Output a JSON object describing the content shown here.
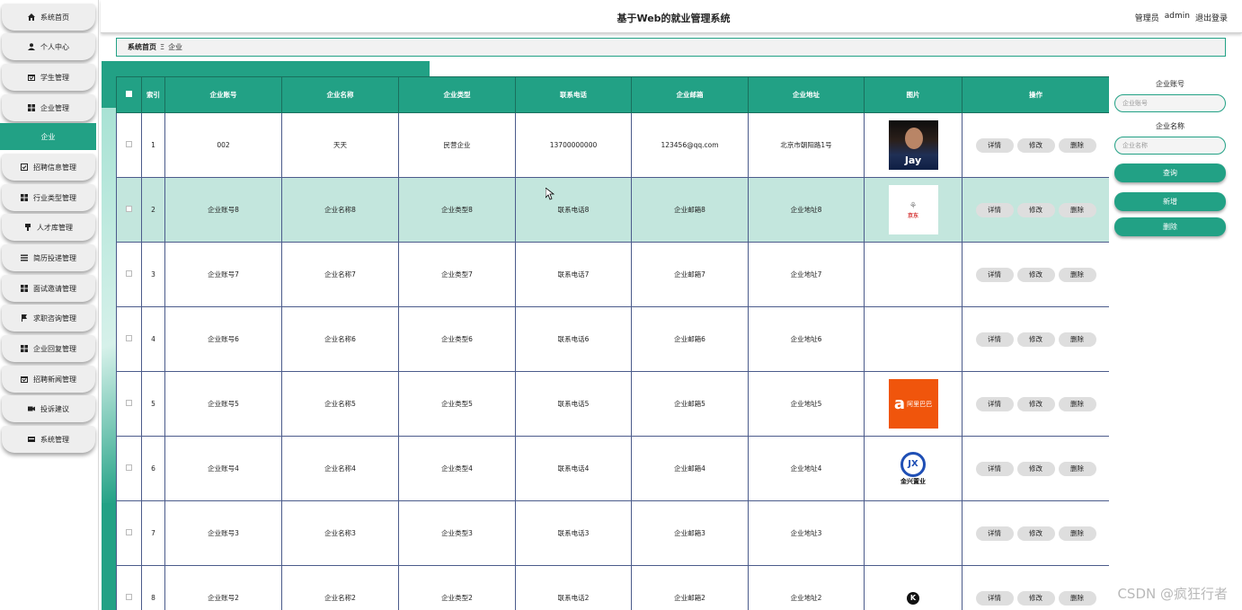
{
  "header": {
    "title": "基于Web的就业管理系统",
    "role": "管理员",
    "username": "admin",
    "logout": "退出登录"
  },
  "sidebar": {
    "items": [
      {
        "label": "系统首页",
        "icon": "home-icon"
      },
      {
        "label": "个人中心",
        "icon": "person-icon"
      },
      {
        "label": "学生管理",
        "icon": "calendar-icon"
      },
      {
        "label": "企业管理",
        "icon": "grid-icon"
      },
      {
        "label": "企业",
        "icon": "",
        "active": true
      },
      {
        "label": "招聘信息管理",
        "icon": "checklist-icon"
      },
      {
        "label": "行业类型管理",
        "icon": "grid-icon"
      },
      {
        "label": "人才库管理",
        "icon": "pin-icon"
      },
      {
        "label": "简历投递管理",
        "icon": "list-icon"
      },
      {
        "label": "面试邀请管理",
        "icon": "grid-icon"
      },
      {
        "label": "求职咨询管理",
        "icon": "flag-icon"
      },
      {
        "label": "企业回复管理",
        "icon": "grid-icon"
      },
      {
        "label": "招聘新闻管理",
        "icon": "calendar-icon"
      },
      {
        "label": "投诉建议",
        "icon": "video-icon"
      },
      {
        "label": "系统管理",
        "icon": "box-icon"
      }
    ]
  },
  "breadcrumb": {
    "home": "系统首页",
    "separator": "Ξ",
    "current": "企业"
  },
  "table": {
    "columns": [
      "索引",
      "企业账号",
      "企业名称",
      "企业类型",
      "联系电话",
      "企业邮箱",
      "企业地址",
      "图片",
      "操作"
    ],
    "actions": {
      "detail": "详情",
      "edit": "修改",
      "delete": "删除"
    },
    "rows": [
      {
        "index": "1",
        "account": "002",
        "name": "天天",
        "type": "民营企业",
        "phone": "13700000000",
        "email": "123456@qq.com",
        "address": "北京市朝阳路1号",
        "image": "photo-jay",
        "image_text": "Jay"
      },
      {
        "index": "2",
        "account": "企业账号8",
        "name": "企业名称8",
        "type": "企业类型8",
        "phone": "联系电话8",
        "email": "企业邮箱8",
        "address": "企业地址8",
        "image": "logo-jd",
        "image_text": "京东"
      },
      {
        "index": "3",
        "account": "企业账号7",
        "name": "企业名称7",
        "type": "企业类型7",
        "phone": "联系电话7",
        "email": "企业邮箱7",
        "address": "企业地址7",
        "image": "",
        "image_text": ""
      },
      {
        "index": "4",
        "account": "企业账号6",
        "name": "企业名称6",
        "type": "企业类型6",
        "phone": "联系电话6",
        "email": "企业邮箱6",
        "address": "企业地址6",
        "image": "",
        "image_text": ""
      },
      {
        "index": "5",
        "account": "企业账号5",
        "name": "企业名称5",
        "type": "企业类型5",
        "phone": "联系电话5",
        "email": "企业邮箱5",
        "address": "企业地址5",
        "image": "logo-alibaba",
        "image_text": "阿里巴巴"
      },
      {
        "index": "6",
        "account": "企业账号4",
        "name": "企业名称4",
        "type": "企业类型4",
        "phone": "联系电话4",
        "email": "企业邮箱4",
        "address": "企业地址4",
        "image": "logo-jinxing",
        "image_text": "金兴置业"
      },
      {
        "index": "7",
        "account": "企业账号3",
        "name": "企业名称3",
        "type": "企业类型3",
        "phone": "联系电话3",
        "email": "企业邮箱3",
        "address": "企业地址3",
        "image": "",
        "image_text": ""
      },
      {
        "index": "8",
        "account": "企业账号2",
        "name": "企业名称2",
        "type": "企业类型2",
        "phone": "联系电话2",
        "email": "企业邮箱2",
        "address": "企业地址2",
        "image": "logo-k",
        "image_text": "K"
      }
    ]
  },
  "search": {
    "account_label": "企业账号",
    "account_placeholder": "企业账号",
    "name_label": "企业名称",
    "name_placeholder": "企业名称",
    "query": "查询",
    "add": "新增",
    "delete": "删除"
  },
  "watermark": "CSDN @疯狂行者",
  "colors": {
    "accent": "#22a185",
    "highlight": "#c3e6dd"
  }
}
